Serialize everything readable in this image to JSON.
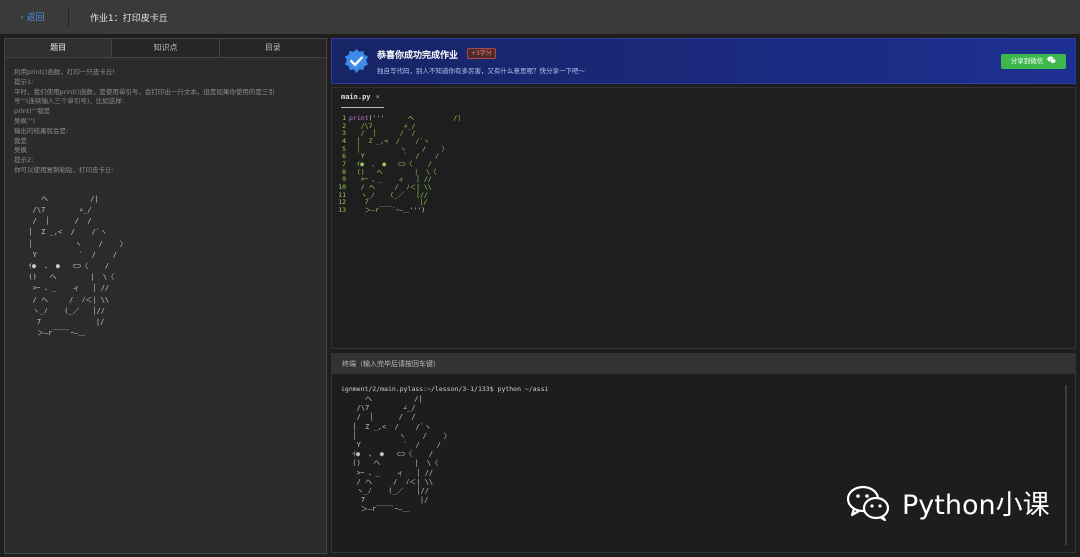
{
  "topbar": {
    "back_label": "返回",
    "title": "作业1：打印皮卡丘"
  },
  "left_panel": {
    "tabs": [
      {
        "label": "题目",
        "active": true
      },
      {
        "label": "知识点",
        "active": false
      },
      {
        "label": "目录",
        "active": false
      }
    ],
    "problem_lines": [
      "利用print()函数，打印一只皮卡丘!",
      "提示1:",
      "平时，我们使用print()函数，是使用单引号，会打印出一行文本。但是如果你使用的是三引",
      "号'''(连续输入三个单引号)，比如这样:",
      "print('''我是",
      "吴枫''')",
      "输出的结果就会是:",
      "我是",
      "吴枫",
      "提示2:",
      "你可以使用复制粘贴，打印皮卡丘:"
    ],
    "ascii_art": "     へ          /|\n   /\\7        ∠_/\n   /  │      /  /\n  │  Z _,<  /    /`ヽ\n  │          ヽ    /    〉\n   Y          `  /    /\n  ｲ●  、 ●   ⊂⊃〈    /\n  ()   へ        |  \\〈\n   >ｰ 、_    ィ   │ //\n   / へ     /  ﾉ＜| \\\\\n   ヽ_ﾉ    (_／   │//\n    7             |/\n    ＞―r￣￣`ｰ―＿"
  },
  "banner": {
    "title": "恭喜你成功完成作业",
    "credit": "+3学分",
    "subtitle": "独自写代码，别人不知道你有多厉害，又有什么意思呢？快分享一下吧～",
    "share_label": "分享到微信"
  },
  "editor": {
    "filename": "main.py",
    "close_glyph": "×",
    "line_numbers": "1\n2\n3\n4\n5\n6\n7\n8\n9\n10\n11\n12\n13",
    "code_keyword": "print",
    "code_open": "('''",
    "code_close": "''')",
    "code_body": "      へ          /|\n   /\\7        ∠_/\n   /  │      /  /\n  │  Z _,<  /    /`ヽ\n  │          ヽ    /    〉\n   Y          `  /    /\n  ｲ●  、 ●   ⊂⊃〈    /\n  ()   へ        |  \\〈\n   >ｰ 、_    ィ   │ //\n   / へ     /  ﾉ＜| \\\\\n   ヽ_ﾉ    (_／   │//\n    7             |/\n    ＞―r￣￣`ｰ―＿"
  },
  "terminal": {
    "header": "终端（输入完毕后请按回车键）",
    "prompt": "ignment/2/main.pylass:~/lesson/3-1/133$ python ~/assi",
    "output": "     へ          /|\n   /\\7        ∠_/\n   /  │      /  /\n  │  Z _,<  /    /`ヽ\n  │          ヽ    /    〉\n   Y          `  /    /\n  ｲ●  、 ●   ⊂⊃〈    /\n  ()   へ        |  \\〈\n   >ｰ 、_    ィ   │ //\n   / へ     /  ﾉ＜| \\\\\n   ヽ_ﾉ    (_／   │//\n    7             |/\n    ＞―r￣￣`ｰ―＿"
  },
  "watermark": {
    "text": "Python小课"
  },
  "colors": {
    "accent": "#4c8fe0",
    "banner": "#1a2a80",
    "share_button": "#3db84d",
    "code_string": "#9acb5c"
  }
}
